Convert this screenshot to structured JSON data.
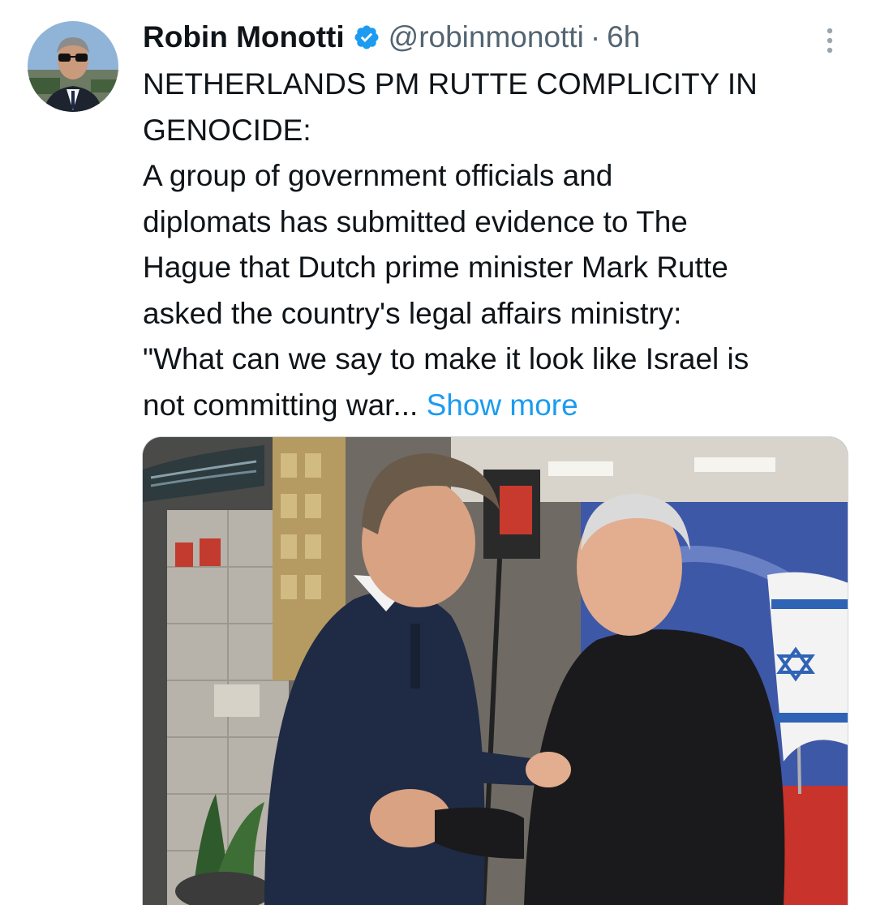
{
  "tweet": {
    "author": {
      "display_name": "Robin Monotti",
      "handle": "@robinmonotti",
      "verified": true,
      "avatar_icon": "profile-photo-avatar"
    },
    "separator": "·",
    "time": "6h",
    "more_icon": "more-options-icon",
    "text_lines": [
      "NETHERLANDS PM RUTTE COMPLICITY IN",
      "GENOCIDE:",
      "A group of government officials and",
      "diplomats has submitted evidence to The",
      "Hague that Dutch prime minister Mark Rutte",
      "asked the country's legal affairs ministry:",
      "\"What can we say to make it look like Israel is",
      "not committing war..."
    ],
    "show_more": "Show more",
    "media": {
      "type": "photo",
      "icon": "attached-photo"
    }
  },
  "colors": {
    "text": "#0f1419",
    "secondary": "#536471",
    "link": "#1d9bf0",
    "verified": "#1d9bf0"
  }
}
